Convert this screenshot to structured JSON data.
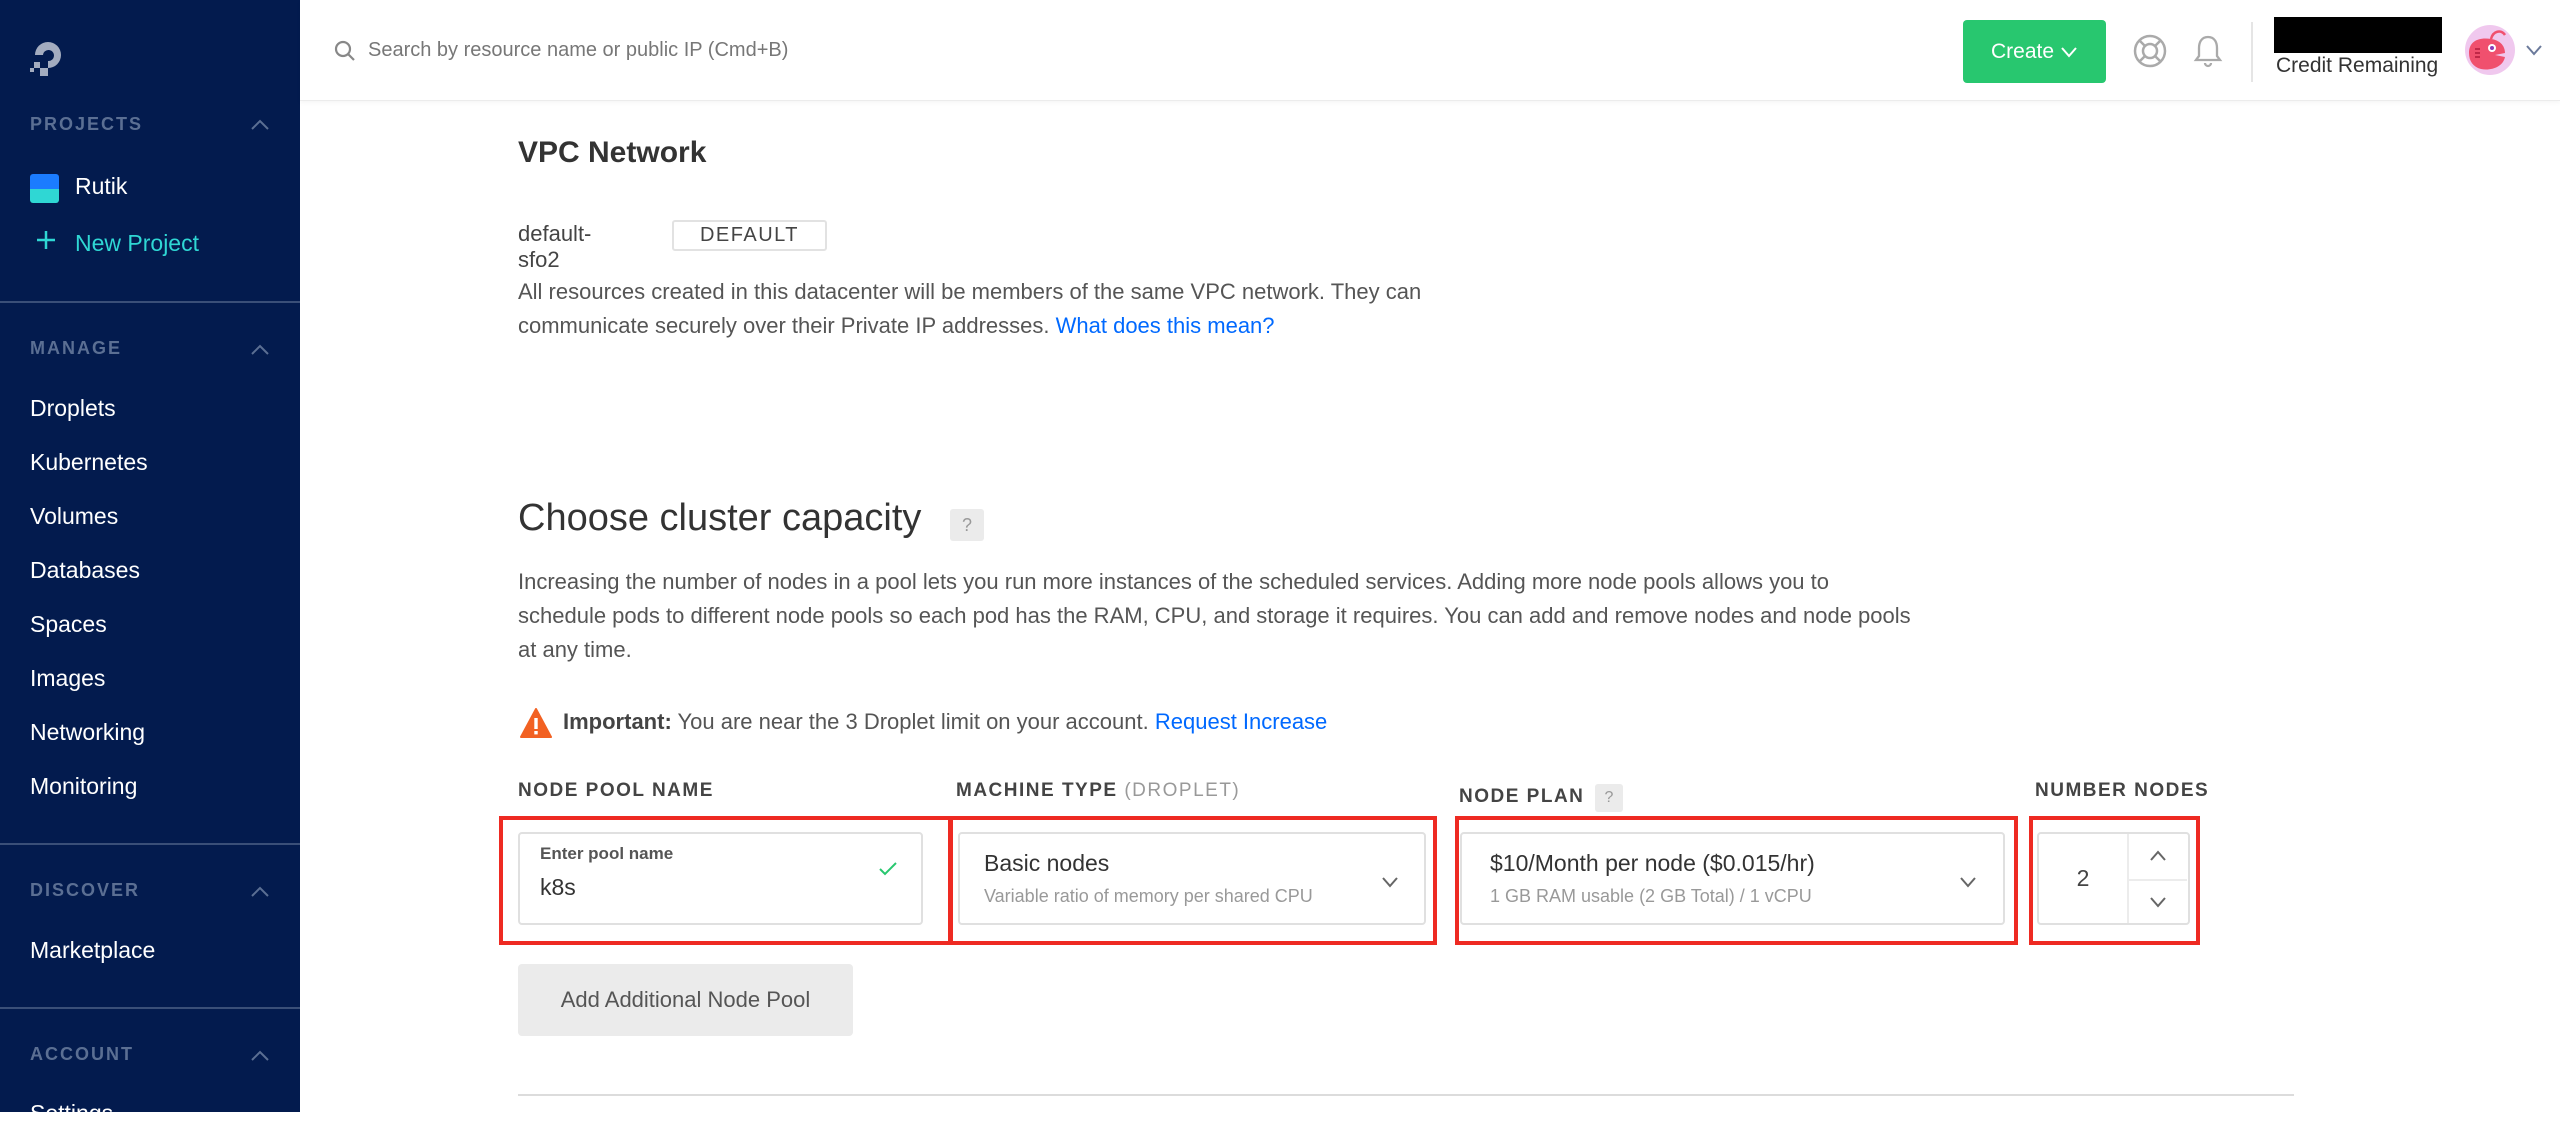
{
  "sidebar": {
    "projects": {
      "heading": "PROJECTS",
      "items": [
        {
          "label": "Rutik",
          "icon": "project-icon"
        },
        {
          "label": "New Project",
          "icon": "plus-icon"
        }
      ]
    },
    "manage": {
      "heading": "MANAGE",
      "items": [
        "Droplets",
        "Kubernetes",
        "Volumes",
        "Databases",
        "Spaces",
        "Images",
        "Networking",
        "Monitoring"
      ]
    },
    "discover": {
      "heading": "DISCOVER",
      "items": [
        "Marketplace"
      ]
    },
    "account": {
      "heading": "ACCOUNT",
      "items": [
        "Settings"
      ]
    }
  },
  "header": {
    "search_placeholder": "Search by resource name or public IP (Cmd+B)",
    "create_label": "Create",
    "credit_label": "Credit Remaining"
  },
  "vpc": {
    "title": "VPC Network",
    "name": "default-sfo2",
    "badge": "DEFAULT",
    "description": "All resources created in this datacenter will be members of the same VPC network. They can communicate securely over their Private IP addresses.",
    "link": "What does this mean?"
  },
  "capacity": {
    "title": "Choose cluster capacity",
    "help": "?",
    "description": "Increasing the number of nodes in a pool lets you run more instances of the scheduled services. Adding more node pools allows you to schedule pods to different node pools so each pod has the RAM, CPU, and storage it requires. You can add and remove nodes and node pools at any time.",
    "warning_bold": "Important:",
    "warning_text": "You are near the 3 Droplet limit on your account.",
    "warning_link": "Request Increase",
    "pool_name": {
      "label": "NODE POOL NAME",
      "field_label": "Enter pool name",
      "value": "k8s"
    },
    "machine_type": {
      "label": "MACHINE TYPE",
      "label_muted": "(DROPLET)",
      "selected": "Basic nodes",
      "selected_sub": "Variable ratio of memory per shared CPU"
    },
    "node_plan": {
      "label": "NODE PLAN",
      "help": "?",
      "selected": "$10/Month per node ($0.015/hr)",
      "selected_sub": "1 GB RAM usable (2 GB Total) / 1 vCPU"
    },
    "number_nodes": {
      "label": "NUMBER NODES",
      "value": "2"
    },
    "add_pool_label": "Add Additional Node Pool"
  },
  "colors": {
    "sidebar_bg": "#031b4e",
    "accent_green": "#28c76f",
    "link_blue": "#0069ff",
    "highlight_red": "#ee2a22",
    "warning_orange": "#f26122"
  }
}
